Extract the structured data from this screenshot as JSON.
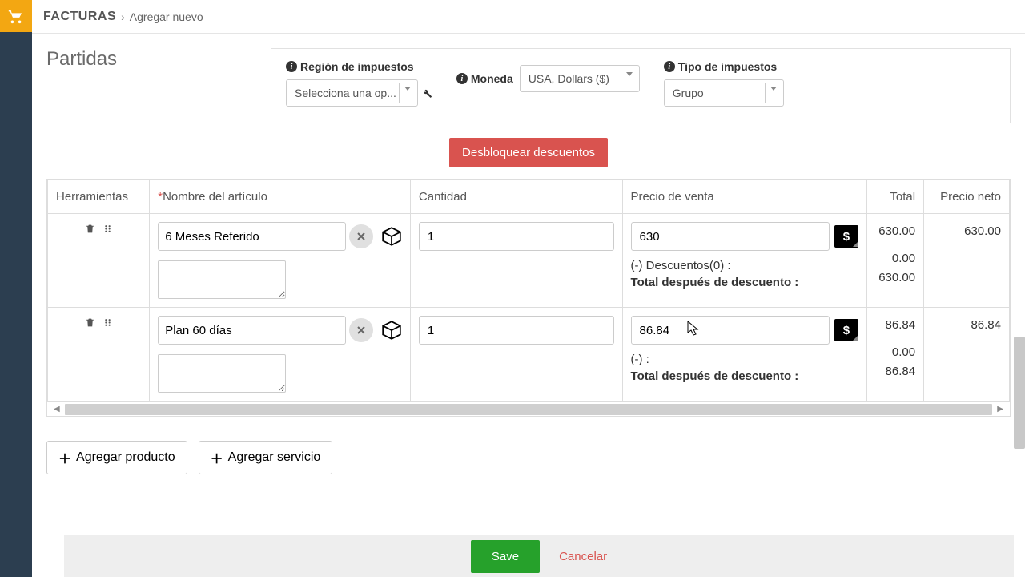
{
  "header": {
    "main": "FACTURAS",
    "sub": "Agregar nuevo"
  },
  "section_title": "Partidas",
  "filters": {
    "region_label": "Región de impuestos",
    "region_placeholder": "Selecciona una op...",
    "currency_label": "Moneda",
    "currency_value": "USA, Dollars ($)",
    "tax_type_label": "Tipo de impuestos",
    "tax_type_value": "Grupo"
  },
  "buttons": {
    "unlock": "Desbloquear descuentos",
    "add_product": "Agregar producto",
    "add_service": "Agregar servicio",
    "save": "Save",
    "cancel": "Cancelar"
  },
  "table": {
    "headers": {
      "tools": "Herramientas",
      "name": "Nombre del artículo",
      "qty": "Cantidad",
      "price": "Precio de venta",
      "total": "Total",
      "net": "Precio neto"
    },
    "rows": [
      {
        "name": "6 Meses Referido",
        "qty": "1",
        "price": "630",
        "discount_label": "(-) Descuentos(0) :",
        "after_label": "Total después de descuento :",
        "total": "630.00",
        "discount_amt": "0.00",
        "after_amt": "630.00",
        "net": "630.00"
      },
      {
        "name": "Plan 60 días",
        "qty": "1",
        "price": "86.84",
        "discount_label": "(-)  :",
        "after_label": "Total después de descuento :",
        "total": "86.84",
        "discount_amt": "0.00",
        "after_amt": "86.84",
        "net": "86.84"
      }
    ]
  }
}
